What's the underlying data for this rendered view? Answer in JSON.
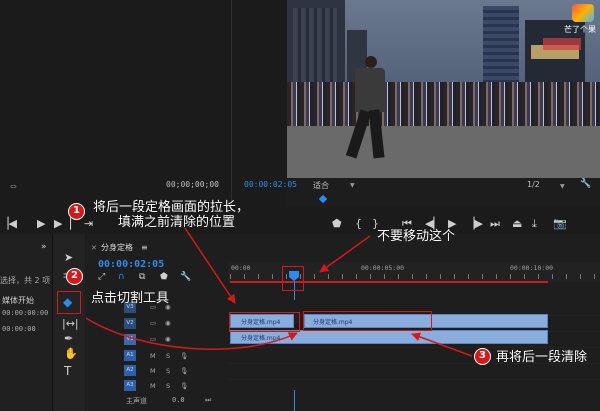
{
  "source_monitor": {
    "timecode": "00;00;00;00"
  },
  "program_monitor": {
    "timecode": "00:00:02:05",
    "zoom": "适合",
    "resolution": "1/2",
    "watermark": "芒了个果"
  },
  "project_panel": {
    "line1": "选择，共 2 项",
    "column_header": "媒体开始",
    "row1": "00:00:00:00",
    "row2": "00:00:00"
  },
  "timeline": {
    "tab_name": "分身定格",
    "timecode": "00:00:02:05",
    "ruler": [
      "00:00",
      "00:00:05:00",
      "00:00:10:00"
    ],
    "tracks_video": [
      "V3",
      "V2",
      "V1"
    ],
    "tracks_audio": [
      "A1",
      "A2",
      "A3"
    ],
    "master_label": "主声道",
    "master_value": "0.0",
    "clip_name": "分身定格.mp4"
  },
  "annotations": {
    "step1_line1": "将后一段定格画面的拉长，",
    "step1_line2": "填满之前清除的位置",
    "step2": "点击切割工具",
    "step3": "再将后一段清除",
    "note_top": "不要移动这个",
    "badge1": "1",
    "badge2": "2",
    "badge3": "3"
  },
  "colors": {
    "accent_blue": "#2d8ceb",
    "clip_blue": "#8aaddd",
    "annotation_red": "#d21a1a",
    "panel_bg": "#1d1d1d"
  }
}
